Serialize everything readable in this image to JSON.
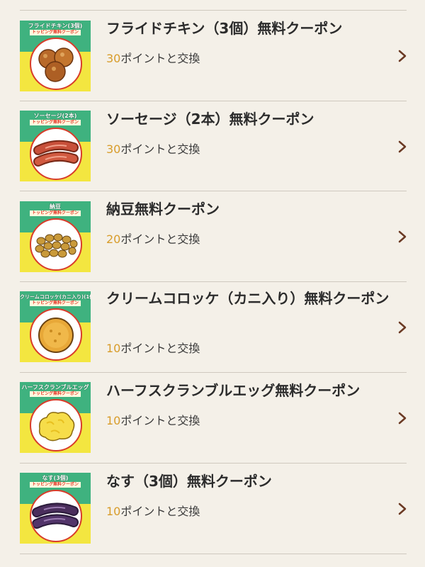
{
  "coupons": [
    {
      "thumb_title": "フライドチキン(3個)",
      "thumb_sub": "トッピング無料クーポン",
      "title": "フライドチキン（3個）無料クーポン",
      "points": "30",
      "points_suffix": "ポイントと交換",
      "food_icon": "fried-chicken-icon"
    },
    {
      "thumb_title": "ソーセージ(2本)",
      "thumb_sub": "トッピング無料クーポン",
      "title": "ソーセージ（2本）無料クーポン",
      "points": "30",
      "points_suffix": "ポイントと交換",
      "food_icon": "sausage-icon"
    },
    {
      "thumb_title": "納豆",
      "thumb_sub": "トッピング無料クーポン",
      "title": "納豆無料クーポン",
      "points": "20",
      "points_suffix": "ポイントと交換",
      "food_icon": "natto-icon"
    },
    {
      "thumb_title": "クリームコロッケ(カニ入り)(1個)",
      "thumb_sub": "トッピング無料クーポン",
      "title": "クリームコロッケ（カニ入り）無料クーポン",
      "points": "10",
      "points_suffix": "ポイントと交換",
      "food_icon": "croquette-icon"
    },
    {
      "thumb_title": "ハーフスクランブルエッグ",
      "thumb_sub": "トッピング無料クーポン",
      "title": "ハーフスクランブルエッグ無料クーポン",
      "points": "10",
      "points_suffix": "ポイントと交換",
      "food_icon": "scrambled-egg-icon"
    },
    {
      "thumb_title": "なす(3個)",
      "thumb_sub": "トッピング無料クーポン",
      "title": "なす（3個）無料クーポン",
      "points": "10",
      "points_suffix": "ポイントと交換",
      "food_icon": "eggplant-icon"
    }
  ],
  "colors": {
    "background": "#f4f0e8",
    "points_accent": "#d89c2a",
    "thumb_green": "#3fb27f",
    "thumb_yellow": "#f3e640",
    "chevron": "#6b3a24"
  }
}
